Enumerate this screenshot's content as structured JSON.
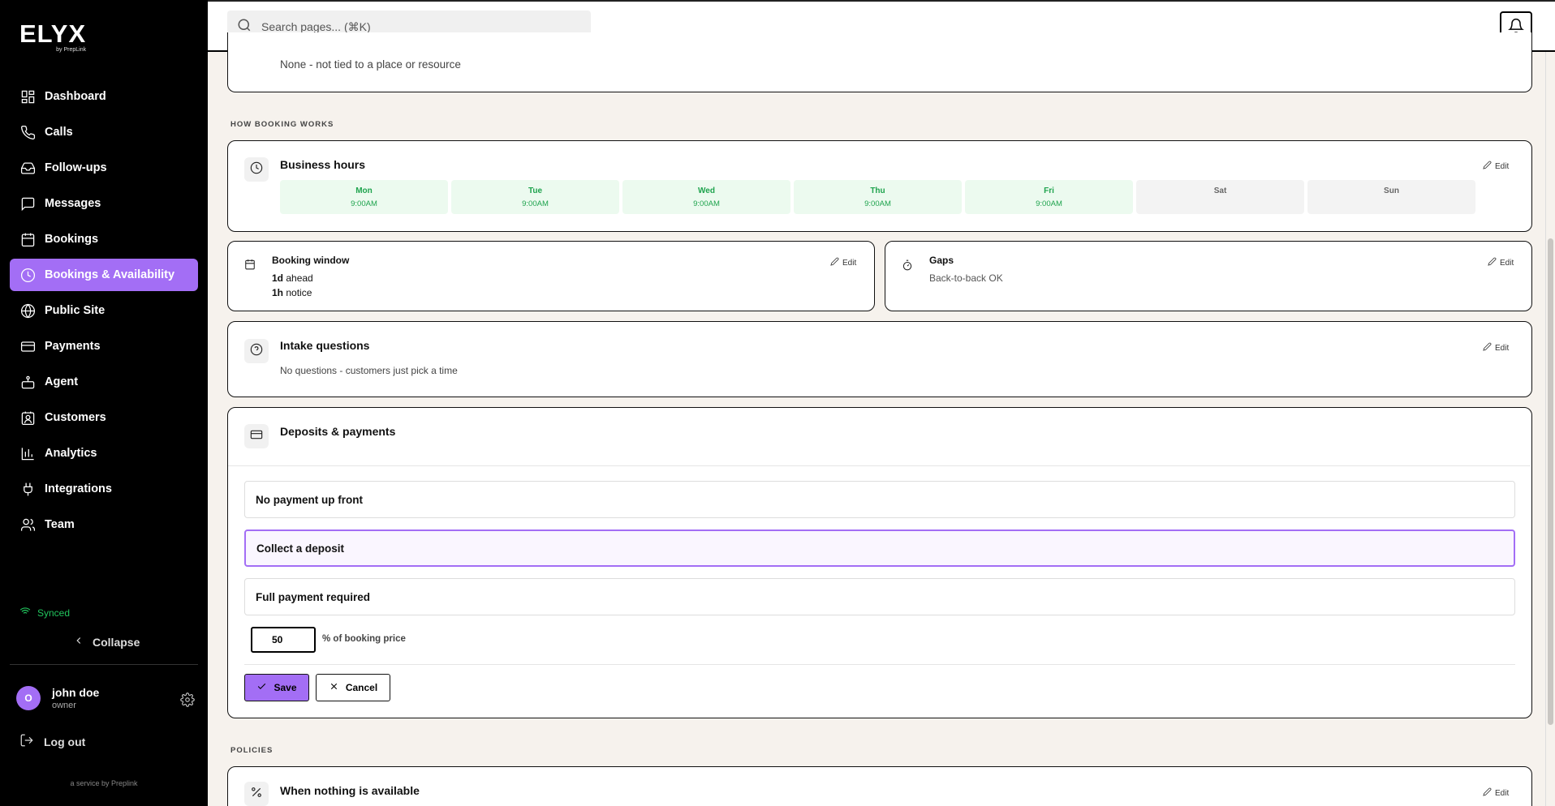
{
  "brand": {
    "name": "ELYX",
    "byline": "by PrepLink"
  },
  "sidebar": {
    "items": [
      {
        "label": "Dashboard",
        "icon": "grid-icon"
      },
      {
        "label": "Calls",
        "icon": "phone-icon"
      },
      {
        "label": "Follow-ups",
        "icon": "inbox-icon"
      },
      {
        "label": "Messages",
        "icon": "message-icon"
      },
      {
        "label": "Bookings",
        "icon": "calendar-icon"
      },
      {
        "label": "Bookings & Availability",
        "icon": "clock-icon",
        "active": true
      },
      {
        "label": "Public Site",
        "icon": "globe-icon"
      },
      {
        "label": "Payments",
        "icon": "card-icon"
      },
      {
        "label": "Agent",
        "icon": "bot-icon"
      },
      {
        "label": "Customers",
        "icon": "contact-icon"
      },
      {
        "label": "Analytics",
        "icon": "chart-icon"
      },
      {
        "label": "Integrations",
        "icon": "plug-icon"
      },
      {
        "label": "Team",
        "icon": "users-icon"
      }
    ],
    "sync_status": "Synced",
    "collapse_label": "Collapse",
    "user": {
      "initial": "O",
      "name": "john doe",
      "role": "owner"
    },
    "logout_label": "Log out",
    "service_note": "a service by Preplink"
  },
  "topbar": {
    "search_placeholder": "Search pages... (⌘K)"
  },
  "resource": {
    "text": "None - not tied to a place or resource"
  },
  "sections": {
    "how_booking_works": "HOW BOOKING WORKS",
    "policies": "POLICIES"
  },
  "business_hours": {
    "title": "Business hours",
    "edit": "Edit",
    "days": [
      {
        "name": "Mon",
        "time": "9:00AM",
        "open": true
      },
      {
        "name": "Tue",
        "time": "9:00AM",
        "open": true
      },
      {
        "name": "Wed",
        "time": "9:00AM",
        "open": true
      },
      {
        "name": "Thu",
        "time": "9:00AM",
        "open": true
      },
      {
        "name": "Fri",
        "time": "9:00AM",
        "open": true
      },
      {
        "name": "Sat",
        "time": "",
        "open": false
      },
      {
        "name": "Sun",
        "time": "",
        "open": false
      }
    ]
  },
  "booking_window": {
    "title": "Booking window",
    "edit": "Edit",
    "ahead_value": "1d",
    "ahead_label": "ahead",
    "notice_value": "1h",
    "notice_label": "notice"
  },
  "gaps": {
    "title": "Gaps",
    "edit": "Edit",
    "text": "Back-to-back OK"
  },
  "intake": {
    "title": "Intake questions",
    "edit": "Edit",
    "text": "No questions - customers just pick a time"
  },
  "deposits": {
    "title": "Deposits & payments",
    "options": [
      "No payment up front",
      "Collect a deposit",
      "Full payment required"
    ],
    "selected_index": 1,
    "percent_value": "50",
    "percent_label": "% of booking price",
    "save_label": "Save",
    "cancel_label": "Cancel"
  },
  "nothing_available": {
    "title": "When nothing is available",
    "edit": "Edit"
  },
  "colors": {
    "accent": "#a36ef5",
    "open_day_bg": "#ecfaef",
    "open_day_text": "#1ea34d",
    "synced": "#21c45d",
    "page_bg": "#f6f2ed"
  }
}
